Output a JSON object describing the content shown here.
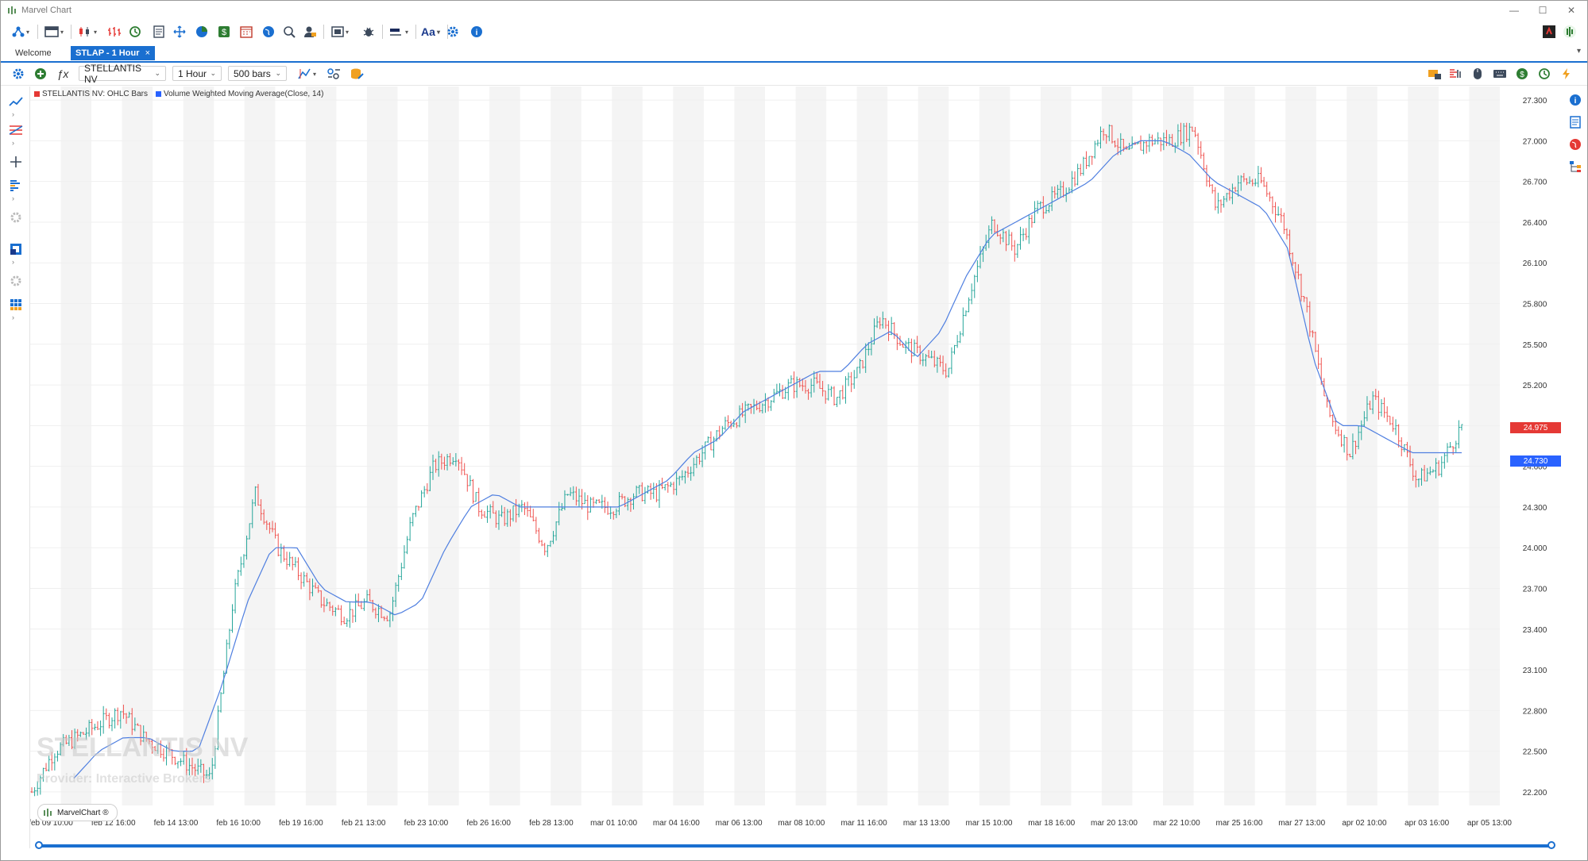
{
  "window": {
    "title": "Marvel Chart"
  },
  "tabs": [
    {
      "label": "Welcome"
    },
    {
      "label": "STLAP - 1 Hour",
      "close": "×"
    }
  ],
  "toolbar": {
    "symbol": "STELLANTIS NV",
    "timeframe": "1 Hour",
    "bars": "500 bars",
    "font_label": "Aa"
  },
  "legend": {
    "series1": "STELLANTIS NV: OHLC Bars",
    "series2": "Volume Weighted Moving Average(Close, 14)"
  },
  "watermark": {
    "name": "STELLANTIS NV",
    "provider": "Provider: Interactive Brokers"
  },
  "badge": {
    "label": "MarvelChart ®"
  },
  "colors": {
    "up": "#26a69a",
    "down": "#ef5350",
    "vwma": "#4f7fe0",
    "accent": "#1a6fd0",
    "last_price": "#e53935",
    "vwma_tag": "#2962ff"
  },
  "chart_data": {
    "type": "line",
    "title": "",
    "ylim": [
      22.1,
      27.4
    ],
    "y_ticks": [
      "27.300",
      "27.000",
      "26.700",
      "26.400",
      "26.100",
      "25.800",
      "25.500",
      "25.200",
      "24.900",
      "24.600",
      "24.300",
      "24.000",
      "23.700",
      "23.400",
      "23.100",
      "22.800",
      "22.500",
      "22.200"
    ],
    "x_ticks": [
      "feb 09 10:00",
      "feb 12 16:00",
      "feb 14 13:00",
      "feb 16 10:00",
      "feb 19 16:00",
      "feb 21 13:00",
      "feb 23 10:00",
      "feb 26 16:00",
      "feb 28 13:00",
      "mar 01 10:00",
      "mar 04 16:00",
      "mar 06 13:00",
      "mar 08 10:00",
      "mar 11 16:00",
      "mar 13 13:00",
      "mar 15 10:00",
      "mar 18 16:00",
      "mar 20 13:00",
      "mar 22 10:00",
      "mar 25 16:00",
      "mar 27 13:00",
      "apr 02 10:00",
      "apr 03 16:00",
      "apr 05 13:00"
    ],
    "series": [
      {
        "name": "STELLANTIS NV: OHLC Bars",
        "values": [
          22.2,
          22.5,
          22.6,
          22.7,
          22.8,
          22.6,
          22.5,
          22.4,
          22.3,
          23.6,
          24.4,
          24.0,
          23.8,
          23.6,
          23.5,
          23.6,
          23.5,
          24.2,
          24.6,
          24.7,
          24.3,
          24.2,
          24.3,
          24.0,
          24.4,
          24.3,
          24.3,
          24.4,
          24.4,
          24.5,
          24.7,
          24.9,
          25.0,
          25.1,
          25.2,
          25.2,
          25.1,
          25.3,
          25.7,
          25.5,
          25.4,
          25.3,
          25.9,
          26.4,
          26.2,
          26.5,
          26.6,
          26.8,
          27.1,
          26.9,
          27.0,
          27.0,
          27.1,
          26.5,
          26.7,
          26.7,
          26.4,
          25.8,
          25.0,
          24.7,
          25.1,
          24.9,
          24.5,
          24.6,
          24.9
        ]
      },
      {
        "name": "Volume Weighted Moving Average(Close, 14)",
        "values": [
          22.3,
          22.5,
          22.6,
          22.6,
          22.5,
          22.5,
          23.0,
          23.6,
          24.0,
          24.0,
          23.7,
          23.6,
          23.6,
          23.5,
          23.6,
          24.0,
          24.3,
          24.4,
          24.3,
          24.3,
          24.3,
          24.3,
          24.3,
          24.4,
          24.5,
          24.7,
          24.8,
          25.0,
          25.1,
          25.2,
          25.3,
          25.3,
          25.5,
          25.6,
          25.4,
          25.6,
          26.0,
          26.3,
          26.4,
          26.5,
          26.6,
          26.7,
          26.9,
          27.0,
          27.0,
          26.9,
          26.7,
          26.6,
          26.5,
          26.2,
          25.4,
          24.9,
          24.9,
          24.8,
          24.7,
          24.7,
          24.7
        ]
      }
    ],
    "last_price": "24.975",
    "vwma_last": "24.730"
  }
}
